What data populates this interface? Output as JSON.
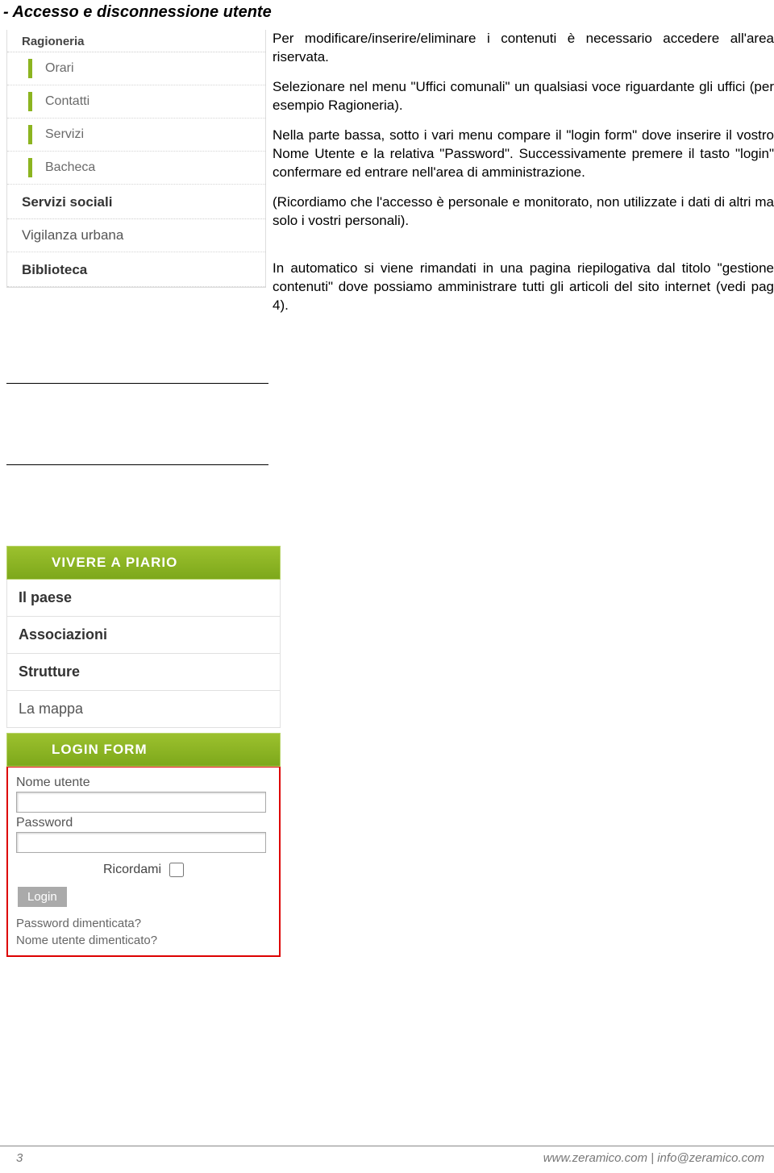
{
  "title": "- Accesso e disconnessione utente",
  "menu1": {
    "top_item": "Ragioneria",
    "subitems": [
      "Orari",
      "Contatti",
      "Servizi",
      "Bacheca"
    ],
    "sections": [
      "Servizi sociali",
      "Vigilanza urbana",
      "Biblioteca"
    ]
  },
  "paragraphs": [
    "Per modificare/inserire/eliminare i contenuti è necessario accedere all'area riservata.",
    "Selezionare nel menu \"Uffici comunali\" un qualsiasi voce riguardante gli uffici (per esempio Ragioneria).",
    "Nella parte bassa, sotto i vari menu compare il \"login form\" dove inserire il vostro Nome Utente e la relativa \"Password\". Successivamente premere il tasto \"login\" confermare ed entrare nell'area di amministrazione.",
    "(Ricordiamo che l'accesso è personale e monitorato, non utilizzate i dati di altri ma solo i vostri personali).",
    "In automatico si viene rimandati in una pagina riepilogativa dal titolo \"gestione contenuti\" dove possiamo amministrare tutti gli articoli del sito internet (vedi pag 4)."
  ],
  "menu2": {
    "header": "VIVERE A PIARIO",
    "items": [
      {
        "label": "Il paese",
        "bold": true
      },
      {
        "label": "Associazioni",
        "bold": true
      },
      {
        "label": "Strutture",
        "bold": true
      },
      {
        "label": "La mappa",
        "bold": false
      }
    ]
  },
  "login": {
    "header": "LOGIN FORM",
    "username_label": "Nome utente",
    "password_label": "Password",
    "remember_label": "Ricordami",
    "button": "Login",
    "forgot_password": "Password dimenticata?",
    "forgot_username": "Nome utente dimenticato?"
  },
  "footer": {
    "page": "3",
    "right": "www.zeramico.com | info@zeramico.com"
  }
}
